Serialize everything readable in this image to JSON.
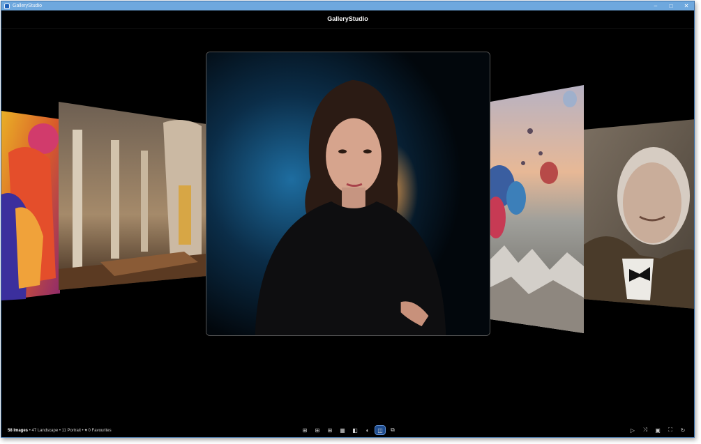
{
  "window": {
    "title": "GalleryStudio",
    "controls": {
      "minimize": "–",
      "maximize": "□",
      "close": "✕"
    }
  },
  "header": {
    "title": "GalleryStudio"
  },
  "carousel": {
    "items": [
      {
        "name": "colorful-fashion-photo"
      },
      {
        "name": "cathedral-interior-photo"
      },
      {
        "name": "woman-portrait-photo",
        "selected": true
      },
      {
        "name": "hot-air-balloons-photo"
      },
      {
        "name": "elderly-man-portrait-photo"
      }
    ]
  },
  "status": {
    "count": "58 Images",
    "sep": "•",
    "landscape": "47 Landscape",
    "portrait": "11 Portrait",
    "favourites": "♥ 0 Favourites"
  },
  "toolbar": {
    "icons": [
      "grid-small-icon",
      "grid-medium-icon",
      "grid-large-icon",
      "mosaic-icon",
      "single-view-icon",
      "circle-view-icon",
      "carousel-view-icon",
      "stack-view-icon"
    ],
    "glyphs": [
      "⊞",
      "⊞",
      "⊞",
      "▦",
      "◧",
      "◐",
      "◫",
      "⧉"
    ],
    "active_index": 6
  },
  "right_tools": {
    "play": "▷",
    "shuffle": "⤨",
    "image": "▣",
    "fullscreen": "⛶",
    "refresh": "↻"
  },
  "colors": {
    "accent": "#1f4d8f",
    "titlebar": "#6ea8de",
    "background": "#000000"
  }
}
